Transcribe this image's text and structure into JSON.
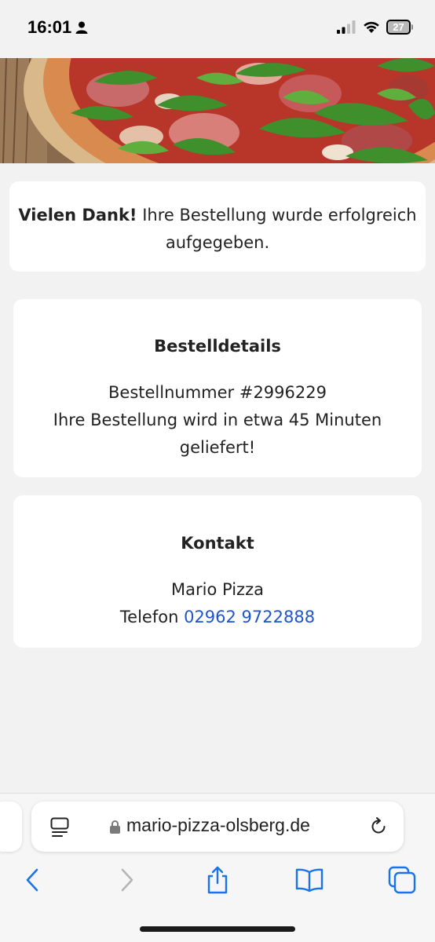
{
  "status_bar": {
    "time": "16:01",
    "battery": "27"
  },
  "confirmation": {
    "bold": "Vielen Dank!",
    "text": " Ihre Bestellung wurde erfolgreich aufgegeben."
  },
  "order_details": {
    "title": "Bestelldetails",
    "order_number": "Bestellnummer #2996229",
    "delivery": "Ihre Bestellung wird in etwa 45 Minuten geliefert!"
  },
  "contact": {
    "title": "Kontakt",
    "name": "Mario Pizza",
    "phone_label": "Telefon ",
    "phone": "02962 9722888"
  },
  "browser": {
    "url": "mario-pizza-olsberg.de"
  },
  "colors": {
    "link": "#1e56c9",
    "ios_blue": "#1a73e8"
  }
}
